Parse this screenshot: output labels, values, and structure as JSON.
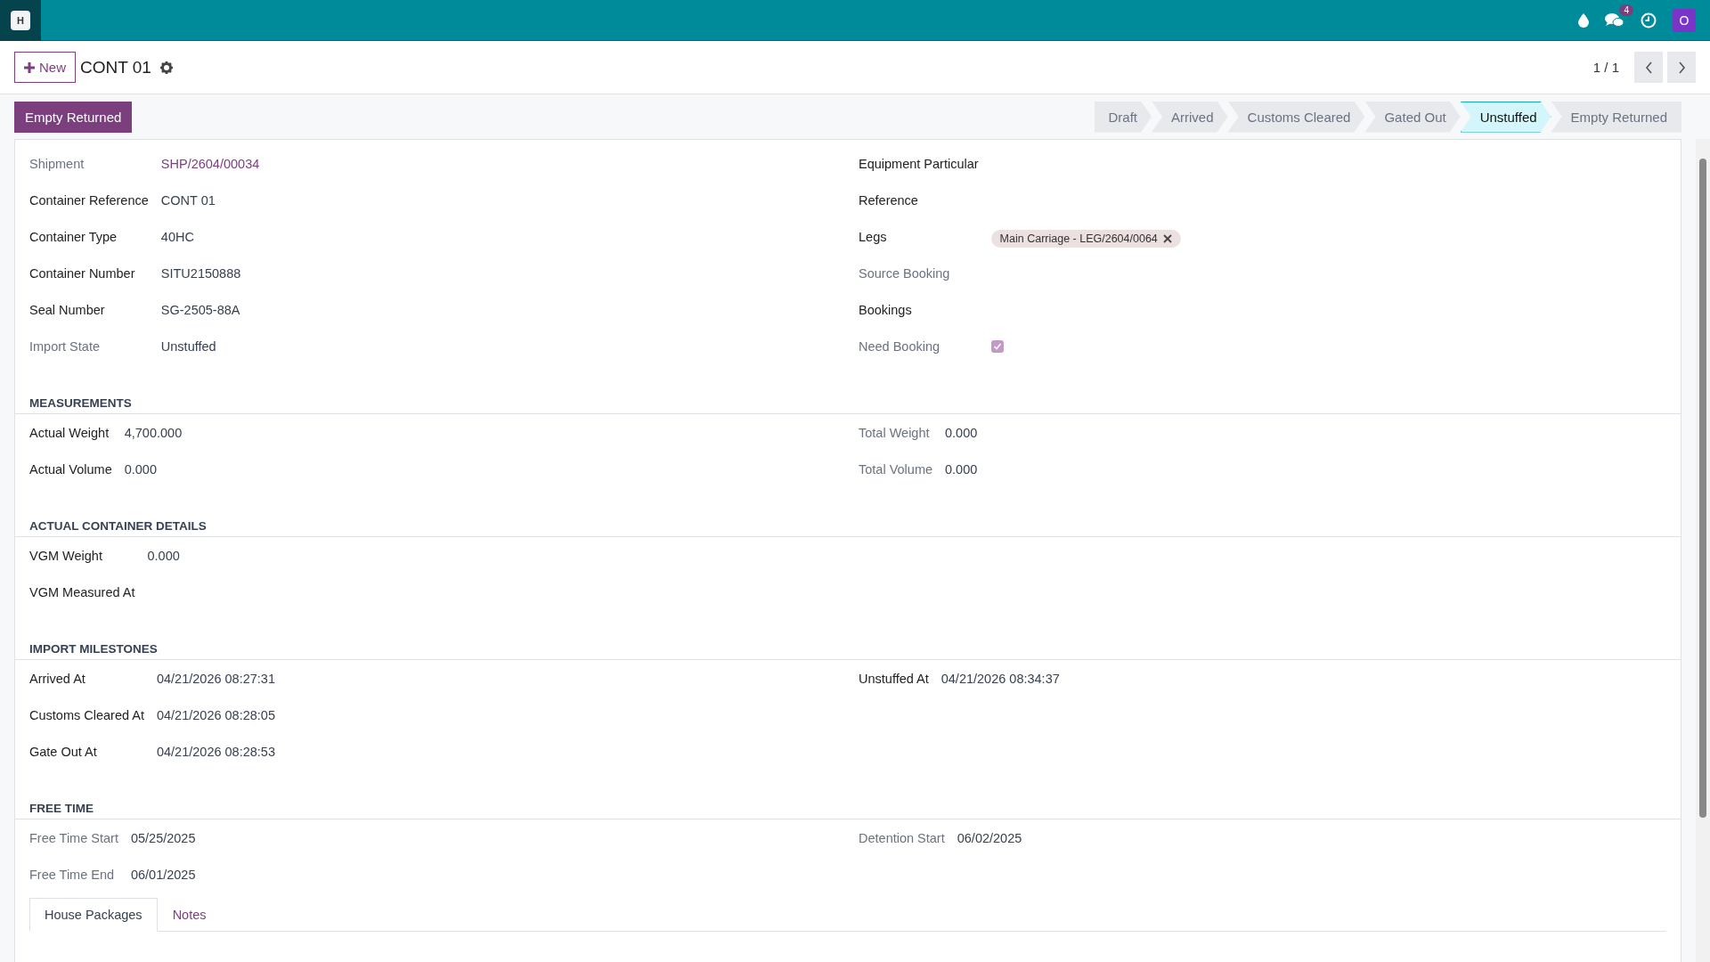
{
  "navbar": {
    "app_letter": "H",
    "chat_badge": "4",
    "avatar_letter": "O"
  },
  "control": {
    "new_button": "New",
    "title": "CONT 01",
    "pager": "1 / 1"
  },
  "header": {
    "action_button": "Empty Returned",
    "stages": [
      {
        "label": "Draft",
        "selected": false
      },
      {
        "label": "Arrived",
        "selected": false
      },
      {
        "label": "Customs Cleared",
        "selected": false
      },
      {
        "label": "Gated Out",
        "selected": false
      },
      {
        "label": "Unstuffed",
        "selected": true
      },
      {
        "label": "Empty Returned",
        "selected": false
      }
    ]
  },
  "top_group": {
    "left": [
      {
        "label": "Shipment",
        "readonly": true,
        "kind": "link",
        "value": "SHP/2604/00034"
      },
      {
        "label": "Container Reference",
        "readonly": false,
        "kind": "text",
        "value": "CONT 01"
      },
      {
        "label": "Container Type",
        "readonly": false,
        "kind": "text",
        "value": "40HC"
      },
      {
        "label": "Container Number",
        "readonly": false,
        "kind": "text",
        "value": "SITU2150888"
      },
      {
        "label": "Seal Number",
        "readonly": false,
        "kind": "text",
        "value": "SG-2505-88A"
      },
      {
        "label": "Import State",
        "readonly": true,
        "kind": "text",
        "value": "Unstuffed"
      }
    ],
    "right": [
      {
        "label": "Equipment Particular",
        "readonly": false,
        "kind": "empty"
      },
      {
        "label": "Reference",
        "readonly": false,
        "kind": "empty"
      },
      {
        "label": "Legs",
        "readonly": false,
        "kind": "tags",
        "tags": [
          "Main Carriage - LEG/2604/0064"
        ]
      },
      {
        "label": "Source Booking",
        "readonly": true,
        "kind": "empty"
      },
      {
        "label": "Bookings",
        "readonly": false,
        "kind": "empty"
      },
      {
        "label": "Need Booking",
        "readonly": true,
        "kind": "checkbox",
        "checked": true
      }
    ]
  },
  "sections": [
    {
      "title": "MEASUREMENTS",
      "left": [
        {
          "label": "Actual Weight",
          "readonly": false,
          "kind": "text",
          "value": "4,700.000"
        },
        {
          "label": "Actual Volume",
          "readonly": false,
          "kind": "text",
          "value": "0.000"
        }
      ],
      "right": [
        {
          "label": "Total Weight",
          "readonly": true,
          "kind": "text",
          "value": "0.000"
        },
        {
          "label": "Total Volume",
          "readonly": true,
          "kind": "text",
          "value": "0.000"
        }
      ]
    },
    {
      "title": "ACTUAL CONTAINER DETAILS",
      "left": [
        {
          "label": "VGM Weight",
          "readonly": false,
          "kind": "text",
          "value": "0.000"
        },
        {
          "label": "VGM Measured At",
          "readonly": false,
          "kind": "empty"
        }
      ]
    },
    {
      "title": "IMPORT MILESTONES",
      "left": [
        {
          "label": "Arrived At",
          "readonly": false,
          "kind": "text",
          "value": "04/21/2026 08:27:31"
        },
        {
          "label": "Customs Cleared At",
          "readonly": false,
          "kind": "text",
          "value": "04/21/2026 08:28:05"
        },
        {
          "label": "Gate Out At",
          "readonly": false,
          "kind": "text",
          "value": "04/21/2026 08:28:53"
        }
      ],
      "right": [
        {
          "label": "Unstuffed At",
          "readonly": false,
          "kind": "text",
          "value": "04/21/2026 08:34:37"
        }
      ]
    },
    {
      "title": "FREE TIME",
      "left": [
        {
          "label": "Free Time Start",
          "readonly": true,
          "kind": "text",
          "value": "05/25/2025"
        },
        {
          "label": "Free Time End",
          "readonly": true,
          "kind": "text",
          "value": "06/01/2025"
        }
      ],
      "right": [
        {
          "label": "Detention Start",
          "readonly": true,
          "kind": "text",
          "value": "06/02/2025"
        }
      ]
    }
  ],
  "tabs": [
    {
      "label": "House Packages",
      "selected": true
    },
    {
      "label": "Notes",
      "selected": false
    }
  ]
}
